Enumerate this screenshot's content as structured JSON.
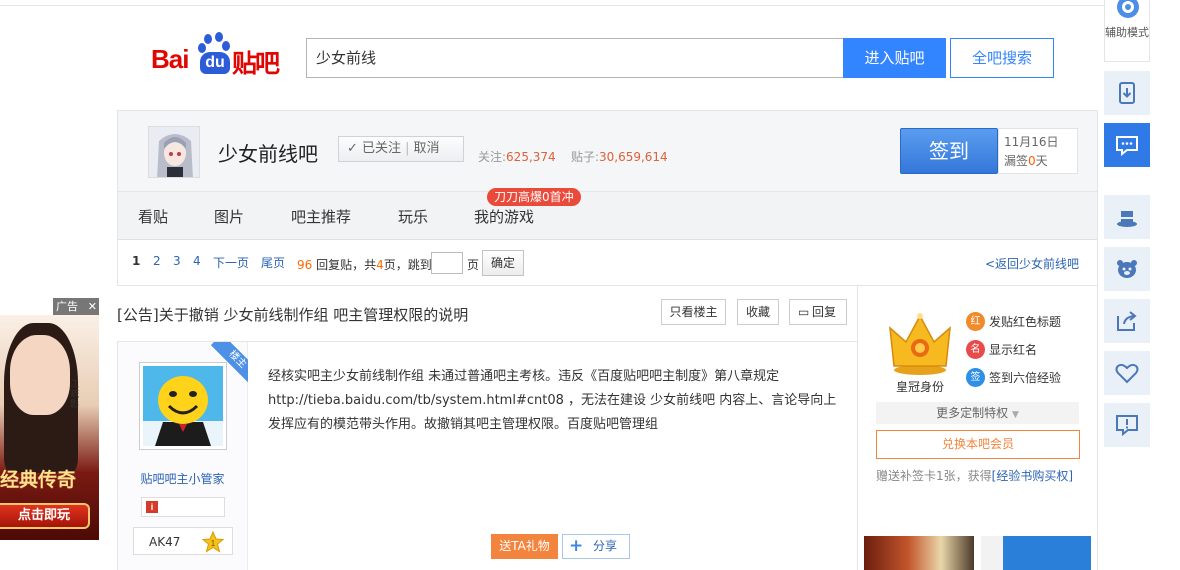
{
  "header": {
    "logo": {
      "bai": "Bai",
      "du": "du",
      "tieba": "贴吧"
    },
    "search_value": "少女前线",
    "enter_label": "进入贴吧",
    "search_all_label": "全吧搜索"
  },
  "forum": {
    "name": "少女前线吧",
    "followed_label": "已关注",
    "unfollow_label": "取消",
    "followers_label": "关注:",
    "followers": "625,374",
    "posts_label": "贴子:",
    "posts": "30,659,614",
    "sign_label": "签到",
    "sign_date": "11月16日",
    "missed_prefix": "漏签",
    "missed_count": "0",
    "missed_suffix": "天"
  },
  "nav": {
    "items": [
      "看贴",
      "图片",
      "吧主推荐",
      "玩乐",
      "我的游戏"
    ],
    "badge": "刀刀高爆0首冲"
  },
  "pager": {
    "pages": [
      "1",
      "2",
      "3",
      "4"
    ],
    "next": "下一页",
    "last": "尾页",
    "reply_count": "96",
    "reply_label": "回复贴，共",
    "page_count": "4",
    "page_label": "页，跳到",
    "page_suffix": "页",
    "confirm": "确定",
    "back": "<返回少女前线吧"
  },
  "thread": {
    "title": "[公告]关于撤销 少女前线制作组 吧主管理权限的说明",
    "only_owner": "只看楼主",
    "collect": "收藏",
    "reply": "回复"
  },
  "post": {
    "ribbon": "楼主",
    "author": "贴吧吧主小管家",
    "badge_icon": "i",
    "level_name": "AK47",
    "content": [
      "经核实吧主少女前线制作组 未通过普通吧主考核。违反《百度贴吧吧主制度》第八章规定",
      "http://tieba.baidu.com/tb/system.html#cnt08 ，无法在建设 少女前线吧 内容上、言论导向上",
      "发挥应有的模范带头作用。故撤销其吧主管理权限。百度贴吧管理组"
    ],
    "gift": "送TA礼物",
    "share": "分享"
  },
  "vip": {
    "crown_label": "皇冠身份",
    "privileges": [
      {
        "icon": "红",
        "text": "发贴红色标题",
        "color": "#f08a2a"
      },
      {
        "icon": "名",
        "text": "显示红名",
        "color": "#e84b4b"
      },
      {
        "icon": "签",
        "text": "签到六倍经验",
        "color": "#2d8fe6"
      }
    ],
    "more": "更多定制特权",
    "redeem": "兑换本吧会员",
    "card_text": "赠送补签卡1张，获得",
    "card_link": "[经验书购买权]"
  },
  "ad": {
    "tag": "广告",
    "close": "✕",
    "name": "江疏影",
    "title": "经典传奇",
    "button": "点击即玩"
  },
  "sidebar": {
    "assist_label": "辅助模式"
  }
}
